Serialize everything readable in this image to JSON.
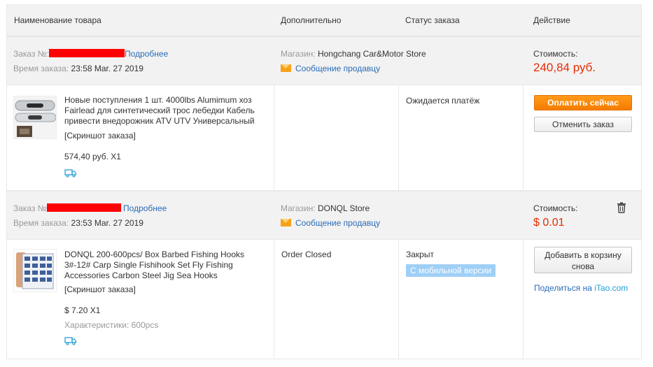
{
  "header": {
    "col_product": "Наименование товара",
    "col_extra": "Дополнительно",
    "col_status": "Статус заказа",
    "col_action": "Действие"
  },
  "orders": [
    {
      "order_label": "Заказ №:",
      "details_link": "Подробнее",
      "time_label": "Время заказа:",
      "time_value": "23:58 Mar. 27 2019",
      "store_label": "Магазин:",
      "store_name": "Hongchang Car&Motor Store",
      "message_link": "Сообщение продавцу",
      "cost_label": "Стоимость:",
      "cost_value": "240,84 руб.",
      "product_title": "Новые поступления 1 шт. 4000lbs Alumimum хоз Fairlead для синтетический трос лебедки Кабель привести внедорожник ATV UTV Универсальный",
      "snapshot": "[Скриншот заказа]",
      "unit_price": "574,40 руб. X1",
      "status": "Ожидается платёж",
      "pay_button": "Оплатить сейчас",
      "cancel_button": "Отменить заказ",
      "thumb_icon": "winch-fairlead-photo",
      "ship_icon": "truck-icon"
    },
    {
      "order_label": "Заказ №",
      "details_link": "Подробнее",
      "time_label": "Время заказа:",
      "time_value": "23:53 Mar. 27 2019",
      "store_label": "Магазин:",
      "store_name": "DONQL Store",
      "message_link": "Сообщение продавцу",
      "cost_label": "Стоимость:",
      "cost_value": "$ 0.01",
      "product_title": "DONQL 200-600pcs/ Box Barbed Fishing Hooks 3#-12# Carp Single Fishihook Set Fly Fishing Accessories Carbon Steel Jig Sea Hooks",
      "snapshot": "[Скриншот заказа]",
      "unit_price": "$ 7.20 X1",
      "characteristics": "Характеристики: 600pcs",
      "extra": "Order Closed",
      "status": "Закрыт",
      "mobile_badge": "С мобильной версии",
      "add_cart_button": "Добавить в корзину снова",
      "share_prefix": "Поделиться на ",
      "share_site": "iTao.com",
      "thumb_icon": "fishing-hooks-box-photo",
      "ship_icon": "truck-icon",
      "delete_icon": "trash-icon"
    }
  ],
  "colors": {
    "accent_orange": "#f57c00",
    "price_red": "#e62e04",
    "link_blue": "#2a6bb8",
    "itao_teal": "#1a9fd8",
    "badge_blue": "#9fcff5"
  }
}
